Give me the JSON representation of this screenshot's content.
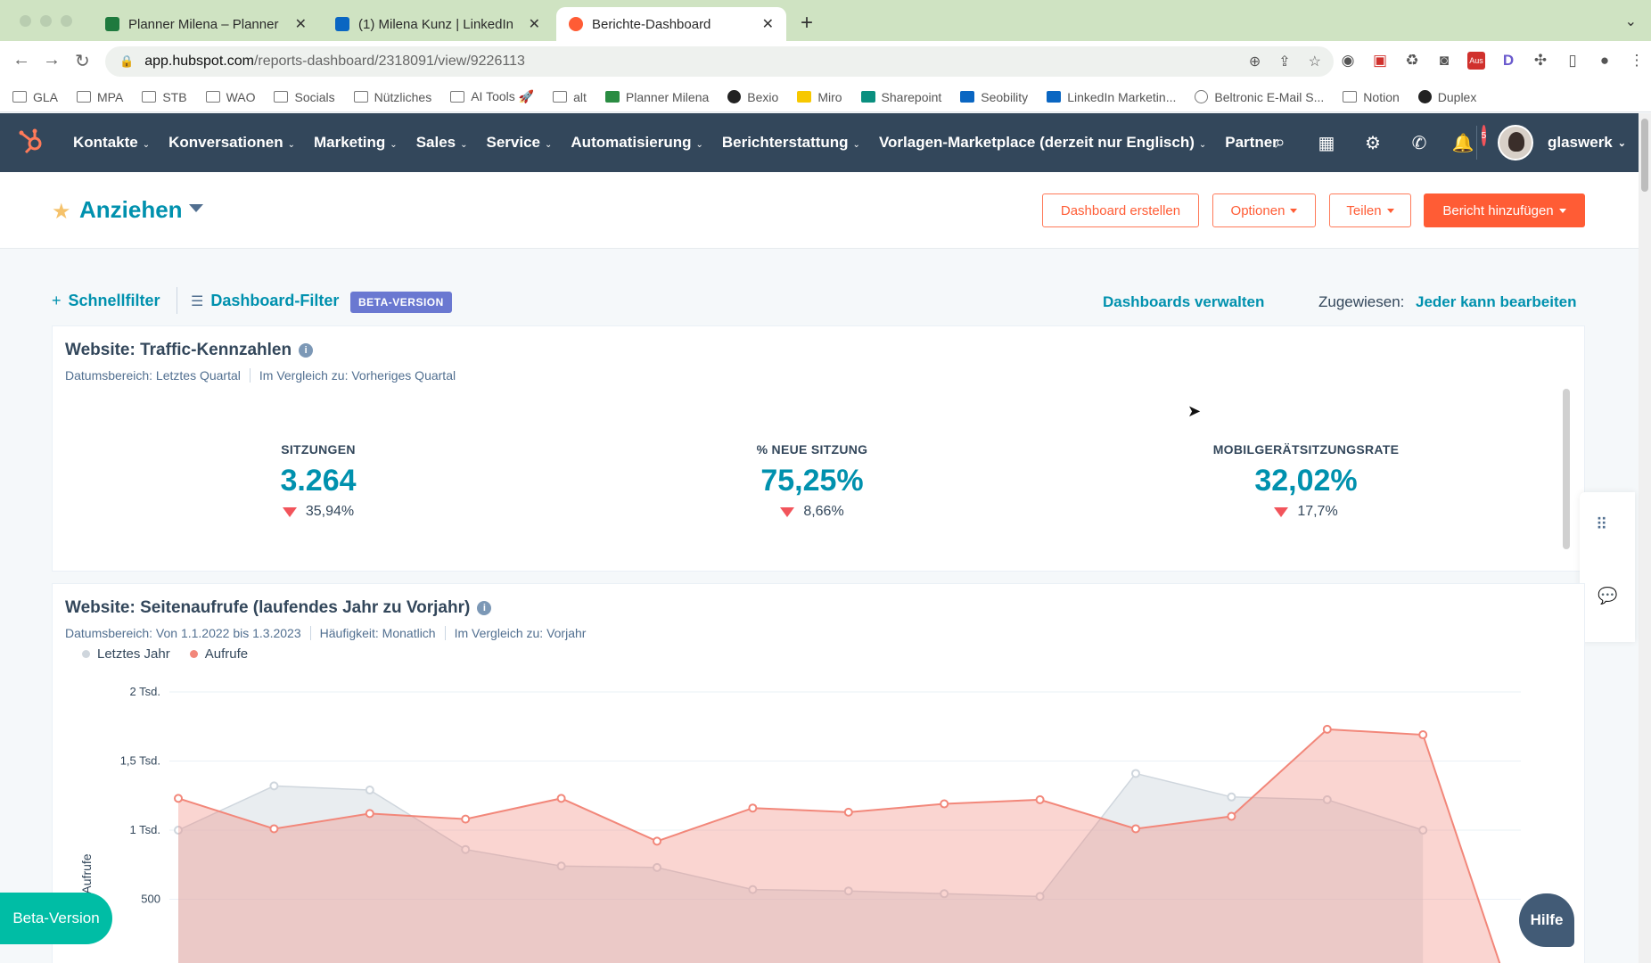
{
  "browser": {
    "tabs": [
      {
        "title": "Planner Milena – Planner",
        "color": "#1f7a3e"
      },
      {
        "title": "(1) Milena Kunz | LinkedIn",
        "color": "#0a66c2"
      },
      {
        "title": "Berichte-Dashboard",
        "color": "#ff5c35"
      }
    ],
    "url_host": "app.hubspot.com",
    "url_path": "/reports-dashboard/2318091/view/9226113",
    "bookmarks": [
      "GLA",
      "MPA",
      "STB",
      "WAO",
      "Socials",
      "Nützliches",
      "AI Tools 🚀",
      "alt",
      "Planner Milena",
      "Bexio",
      "Miro",
      "Sharepoint",
      "Seobility",
      "LinkedIn Marketin...",
      "Beltronic E-Mail S...",
      "Notion",
      "Duplex"
    ],
    "ext_badge": "Aus"
  },
  "nav": {
    "items": [
      "Kontakte",
      "Konversationen",
      "Marketing",
      "Sales",
      "Service",
      "Automatisierung",
      "Berichterstattung",
      "Vorlagen-Marketplace (derzeit nur Englisch)",
      "Partner"
    ],
    "notification_count": "5",
    "account_name": "glaswerk"
  },
  "header": {
    "title": "Anziehen",
    "btn_create": "Dashboard erstellen",
    "btn_options": "Optionen",
    "btn_share": "Teilen",
    "btn_add": "Bericht hinzufügen"
  },
  "filters": {
    "quick": "Schnellfilter",
    "dashboard": "Dashboard-Filter",
    "beta": "BETA-VERSION",
    "manage": "Dashboards verwalten",
    "assigned_label": "Zugewiesen:",
    "assigned_value": "Jeder kann bearbeiten"
  },
  "card1": {
    "title": "Website: Traffic-Kennzahlen",
    "meta": [
      "Datumsbereich: Letztes Quartal",
      "Im Vergleich zu: Vorheriges Quartal"
    ],
    "kpis": [
      {
        "label": "SITZUNGEN",
        "value": "3.264",
        "delta": "35,94%"
      },
      {
        "label": "% NEUE SITZUNG",
        "value": "75,25%",
        "delta": "8,66%"
      },
      {
        "label": "MOBILGERÄTSITZUNGSRATE",
        "value": "32,02%",
        "delta": "17,7%"
      }
    ]
  },
  "card2": {
    "title": "Website: Seitenaufrufe (laufendes Jahr zu Vorjahr)",
    "meta": [
      "Datumsbereich: Von 1.1.2022 bis 1.3.2023",
      "Häufigkeit: Monatlich",
      "Im Vergleich zu: Vorjahr"
    ]
  },
  "chart_data": {
    "type": "area",
    "ylabel": "Aufrufe",
    "yticks": [
      "2 Tsd.",
      "1,5 Tsd.",
      "1 Tsd.",
      "500"
    ],
    "ylim": [
      0,
      2000
    ],
    "series": [
      {
        "name": "Letztes Jahr",
        "color": "#cfd6dd",
        "values": [
          1000,
          1320,
          1290,
          860,
          740,
          730,
          570,
          560,
          540,
          520,
          1410,
          1240,
          1220,
          1000
        ]
      },
      {
        "name": "Aufrufe",
        "color": "#f2877a",
        "values": [
          1230,
          1010,
          1120,
          1080,
          1230,
          920,
          1160,
          1130,
          1190,
          1220,
          1010,
          1100,
          1730,
          1690
        ]
      }
    ],
    "trailing_point": {
      "series": "Aufrufe",
      "value": 0
    }
  },
  "widgets": {
    "beta_button": "Beta-Version",
    "help_button": "Hilfe"
  }
}
